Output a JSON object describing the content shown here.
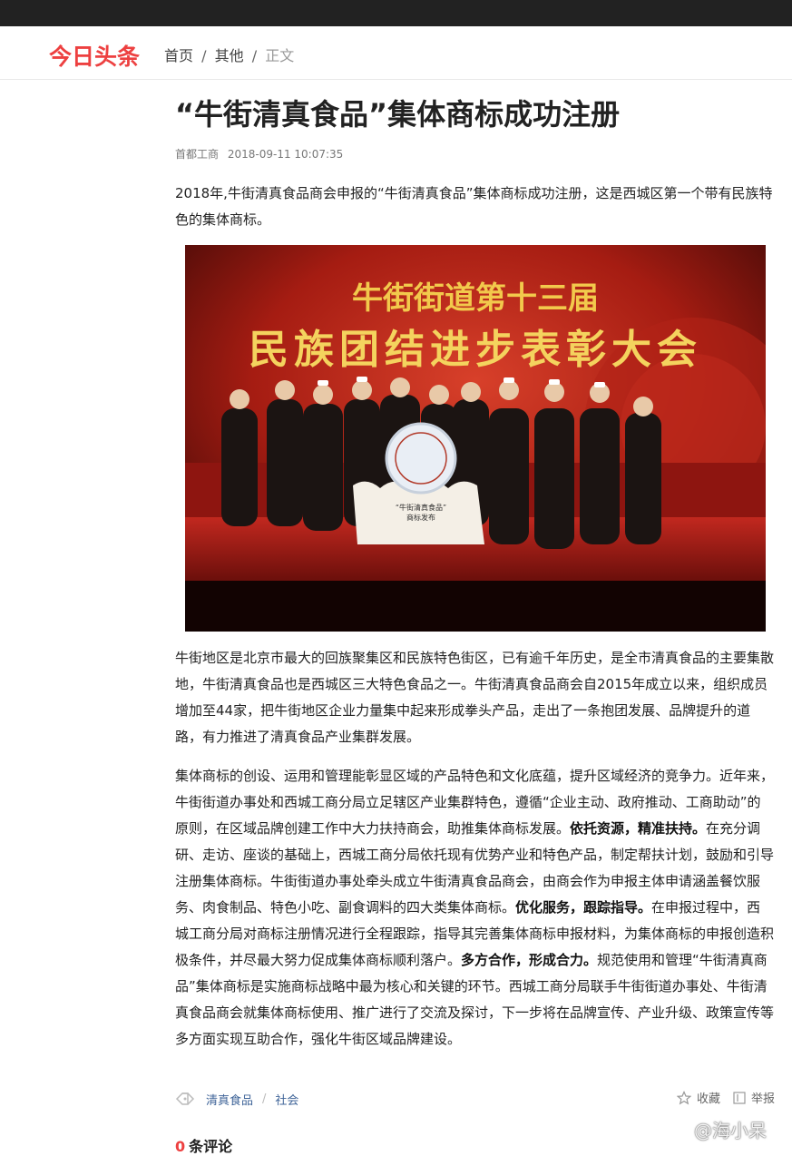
{
  "header": {
    "logo": "今日头条",
    "breadcrumb": {
      "home": "首页",
      "category": "其他",
      "current": "正文",
      "separator": "/"
    }
  },
  "article": {
    "title": "“牛街清真食品”集体商标成功注册",
    "source": "首都工商",
    "time": "2018-09-11 10:07:35",
    "intro": "2018年,牛街清真食品商会申报的“牛街清真食品”集体商标成功注册，这是西城区第一个带有民族特色的集体商标。",
    "photo": {
      "banner_line1": "牛街街道第十三届",
      "banner_line2": "民族团结进步表彰大会",
      "podium_text_1": "“牛街清真食品”",
      "podium_text_2": "商标发布"
    },
    "para2": "牛街地区是北京市最大的回族聚集区和民族特色街区，已有逾千年历史，是全市清真食品的主要集散地，牛街清真食品也是西城区三大特色食品之一。牛街清真食品商会自2015年成立以来，组织成员增加至44家，把牛街地区企业力量集中起来形成拳头产品，走出了一条抱团发展、品牌提升的道路，有力推进了清真食品产业集群发展。",
    "para3": {
      "s1": "集体商标的创设、运用和管理能彰显区域的产品特色和文化底蕴，提升区域经济的竞争力。近年来，牛街街道办事处和西城工商分局立足辖区产业集群特色，遵循“企业主动、政府推动、工商助动”的原则，在区域品牌创建工作中大力扶持商会，助推集体商标发展。",
      "b1": "依托资源，精准扶持。",
      "s2": "在充分调研、走访、座谈的基础上，西城工商分局依托现有优势产业和特色产品，制定帮扶计划，鼓励和引导注册集体商标。牛街街道办事处牵头成立牛街清真食品商会，由商会作为申报主体申请涵盖餐饮服务、肉食制品、特色小吃、副食调料的四大类集体商标。",
      "b2": "优化服务，跟踪指导。",
      "s3": "在申报过程中，西城工商分局对商标注册情况进行全程跟踪，指导其完善集体商标申报材料，为集体商标的申报创造积极条件，并尽最大努力促成集体商标顺利落户。",
      "b3": "多方合作，形成合力。",
      "s4": "规范使用和管理“牛街清真商品”集体商标是实施商标战略中最为核心和关键的环节。西城工商分局联手牛街街道办事处、牛街清真食品商会就集体商标使用、推广进行了交流及探讨，下一步将在品牌宣传、产业升级、政策宣传等多方面实现互助合作，强化牛街区域品牌建设。"
    },
    "tags": [
      "清真食品",
      "社会"
    ],
    "tag_separator": "/",
    "actions": {
      "favorite": "收藏",
      "report": "举报"
    },
    "comments": {
      "count": "0",
      "label": "条评论"
    }
  },
  "watermark": "@海小呆",
  "colors": {
    "brand": "#ed4040",
    "link": "#406599",
    "topbar": "#222222"
  },
  "icons": {
    "tag": "tag-icon",
    "favorite": "star-icon",
    "report": "flag-icon",
    "weibo": "weibo-icon"
  }
}
